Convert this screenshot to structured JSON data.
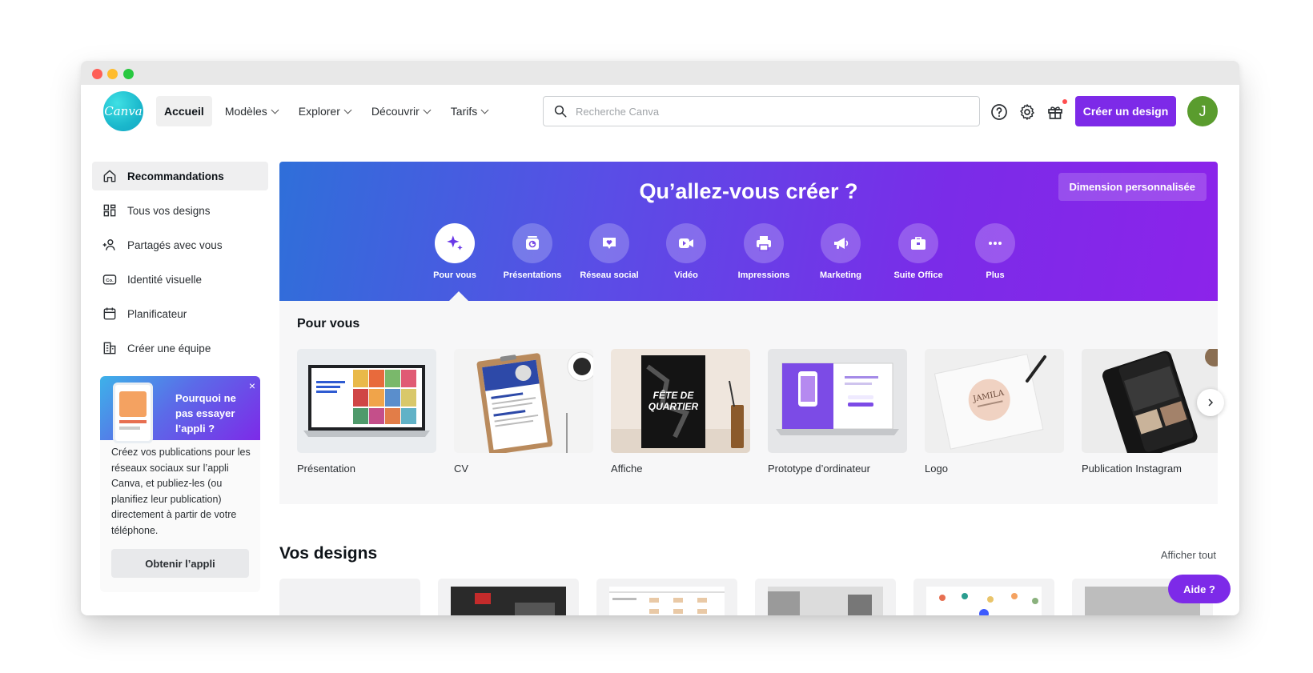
{
  "header": {
    "logo_text": "Canva",
    "nav": [
      {
        "label": "Accueil"
      },
      {
        "label": "Modèles"
      },
      {
        "label": "Explorer"
      },
      {
        "label": "Découvrir"
      },
      {
        "label": "Tarifs"
      }
    ],
    "search_placeholder": "Recherche Canva",
    "create_label": "Créer un design",
    "avatar_initial": "J"
  },
  "sidebar": {
    "items": [
      {
        "label": "Recommandations",
        "icon": "home-icon"
      },
      {
        "label": "Tous vos designs",
        "icon": "grid-icon"
      },
      {
        "label": "Partagés avec vous",
        "icon": "shared-users-icon"
      },
      {
        "label": "Identité visuelle",
        "icon": "brand-kit-icon"
      },
      {
        "label": "Planificateur",
        "icon": "calendar-icon"
      },
      {
        "label": "Créer une équipe",
        "icon": "building-icon"
      }
    ],
    "promo": {
      "title": "Pourquoi ne pas essayer l’appli ?",
      "close": "×",
      "text": "Créez vos publications pour les réseaux sociaux sur l’appli Canva, et publiez-les (ou planifiez leur publication) directement à partir de votre téléphone.",
      "button": "Obtenir l’appli"
    }
  },
  "hero": {
    "title": "Qu’allez-vous créer ?",
    "custom_size": "Dimension personnalisée",
    "categories": [
      {
        "label": "Pour vous",
        "icon": "sparkle-icon"
      },
      {
        "label": "Présentations",
        "icon": "presentation-icon"
      },
      {
        "label": "Réseau social",
        "icon": "heart-chat-icon"
      },
      {
        "label": "Vidéo",
        "icon": "video-icon"
      },
      {
        "label": "Impressions",
        "icon": "printer-icon"
      },
      {
        "label": "Marketing",
        "icon": "megaphone-icon"
      },
      {
        "label": "Suite Office",
        "icon": "briefcase-icon"
      },
      {
        "label": "Plus",
        "icon": "more-dots-icon"
      }
    ]
  },
  "for_you": {
    "title": "Pour vous",
    "cards": [
      {
        "label": "Présentation"
      },
      {
        "label": "CV"
      },
      {
        "label": "Affiche",
        "thumb_text": "FÊTE DE QUARTIER"
      },
      {
        "label": "Prototype d’ordinateur"
      },
      {
        "label": "Logo",
        "thumb_text": "JAMILA"
      },
      {
        "label": "Publication Instagram"
      }
    ]
  },
  "your_designs": {
    "title": "Vos designs",
    "show_all": "Afficher tout"
  },
  "help_label": "Aide ?",
  "colors": {
    "accent": "#7d2ae8",
    "brand_teal": "#1bb8cc",
    "avatar": "#5a9c2e"
  }
}
